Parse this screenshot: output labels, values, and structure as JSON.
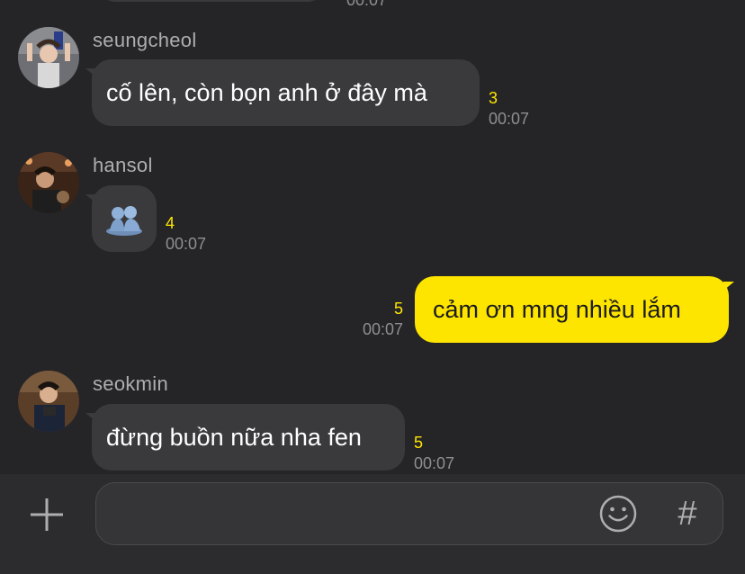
{
  "messages": [
    {
      "sender": "seungcheol",
      "text": "cố lên, còn bọn anh ở đây mà",
      "unread": "3",
      "time": "00:07"
    },
    {
      "sender": "hansol",
      "sticker": "blue-figures-sticker",
      "unread": "4",
      "time": "00:07"
    },
    {
      "sender": "me",
      "text": "cảm ơn mng nhiều lắm",
      "unread": "5",
      "time": "00:07"
    },
    {
      "sender": "seokmin",
      "text": "đừng buồn nữa nha fen",
      "unread": "5",
      "time": "00:07"
    }
  ],
  "previous_message": {
    "time": "00:07"
  },
  "input_bar": {
    "plus_icon": "plus-icon",
    "emoji_icon": "smiley-icon",
    "hash_label": "#"
  },
  "colors": {
    "background": "#252528",
    "incoming_bubble": "#3a3a3d",
    "outgoing_bubble": "#fee500",
    "unread_count": "#fee500",
    "timestamp": "#8e8e93"
  }
}
